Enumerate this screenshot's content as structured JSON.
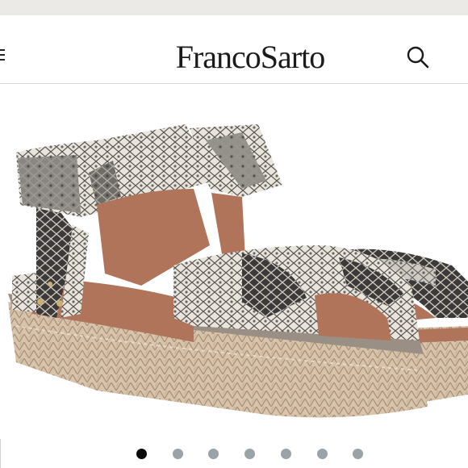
{
  "header": {
    "brand": "FrancoSarto",
    "menu_icon": "hamburger-menu-icon",
    "search_icon": "search-icon"
  },
  "product": {
    "image_icon": "snake-print-espadrille-sandal",
    "colors": {
      "snake_light": "#e9e5dc",
      "snake_dark": "#3c3a38",
      "leather": "#b0745b",
      "jute": "#d8c4ac"
    }
  },
  "carousel": {
    "count": 7,
    "active_index": 0
  }
}
